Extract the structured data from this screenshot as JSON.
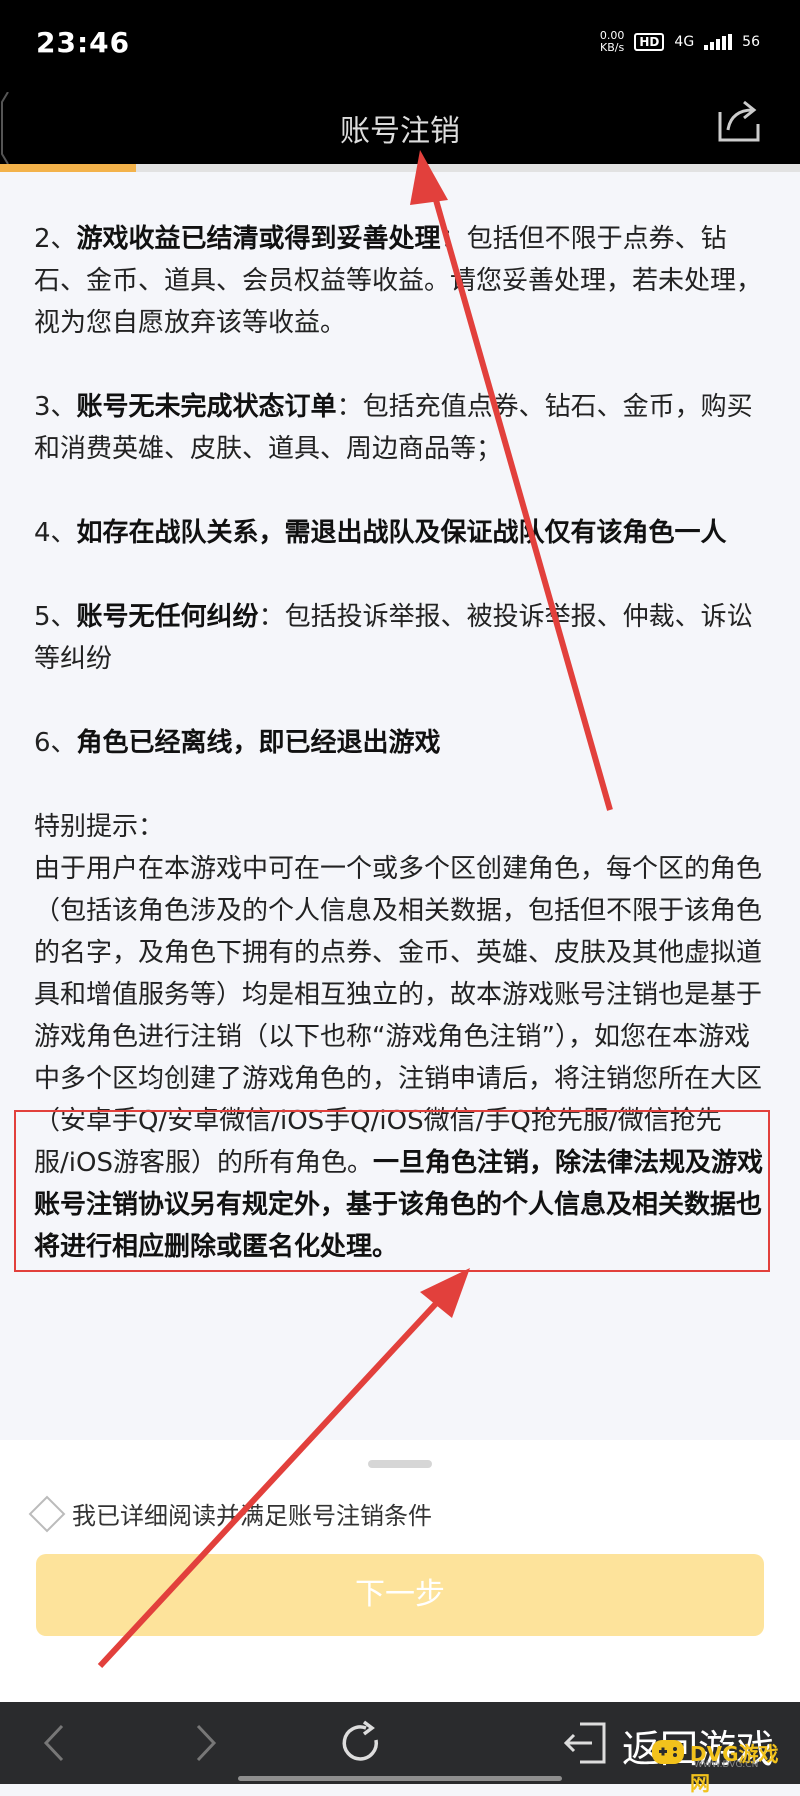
{
  "status_bar": {
    "time": "23:46",
    "net_speed_value": "0.00",
    "net_speed_unit": "KB/s",
    "hd_label": "HD",
    "signal_label": "4G",
    "battery_label": "56"
  },
  "header": {
    "title": "账号注销",
    "share_icon": "share-icon"
  },
  "progress": {
    "value_fraction": 0.17
  },
  "content": {
    "item2_num": "2、",
    "item2_bold": "游戏收益已结清或得到妥善处理",
    "item2_text": "：包括但不限于点券、钻石、金币、道具、会员权益等收益。请您妥善处理，若未处理，视为您自愿放弃该等收益。",
    "item3_num": "3、",
    "item3_bold": "账号无未完成状态订单",
    "item3_text": "：包括充值点券、钻石、金币，购买和消费英雄、皮肤、道具、周边商品等；",
    "item4_num": "4、",
    "item4_bold": "如存在战队关系，需退出战队及保证战队仅有该角色一人",
    "item5_num": "5、",
    "item5_bold": "账号无任何纠纷",
    "item5_text": "：包括投诉举报、被投诉举报、仲裁、诉讼等纠纷",
    "item6_num": "6、",
    "item6_bold": "角色已经离线，即已经退出游戏",
    "notice_title": "特别提示：",
    "notice_text": "由于用户在本游戏中可在一个或多个区创建角色，每个区的角色（包括该角色涉及的个人信息及相关数据，包括但不限于该角色的名字，及角色下拥有的点券、金币、英雄、皮肤及其他虚拟道具和增值服务等）均是相互独立的，故本游戏账号注销也是基于游戏角色进行注销（以下也称“游戏角色注销”），如您在本游戏中多个区均创建了游戏角色的，注销申请后，将注销您所在大区（安卓手Q/安卓微信/iOS手Q/iOS微信/手Q抢先服/微信抢先服/iOS游客服）的所有角色。",
    "notice_bold": "一旦角色注销，除法律法规及游戏账号注销协议另有规定外，基于该角色的个人信息及相关数据也将进行相应删除或匿名化处理。"
  },
  "bottom": {
    "agree_label": "我已详细阅读并满足账号注销条件",
    "agree_checked": false,
    "next_label": "下一步"
  },
  "navbar": {
    "back_label": "返回游戏"
  },
  "watermark": {
    "text": "DVG游戏网",
    "sub": "WWW.DVG.CN"
  },
  "colors": {
    "accent": "#f3b24a",
    "button_disabled": "#fde39b",
    "annotation_red": "#e2403c",
    "header_bg": "#000000"
  }
}
